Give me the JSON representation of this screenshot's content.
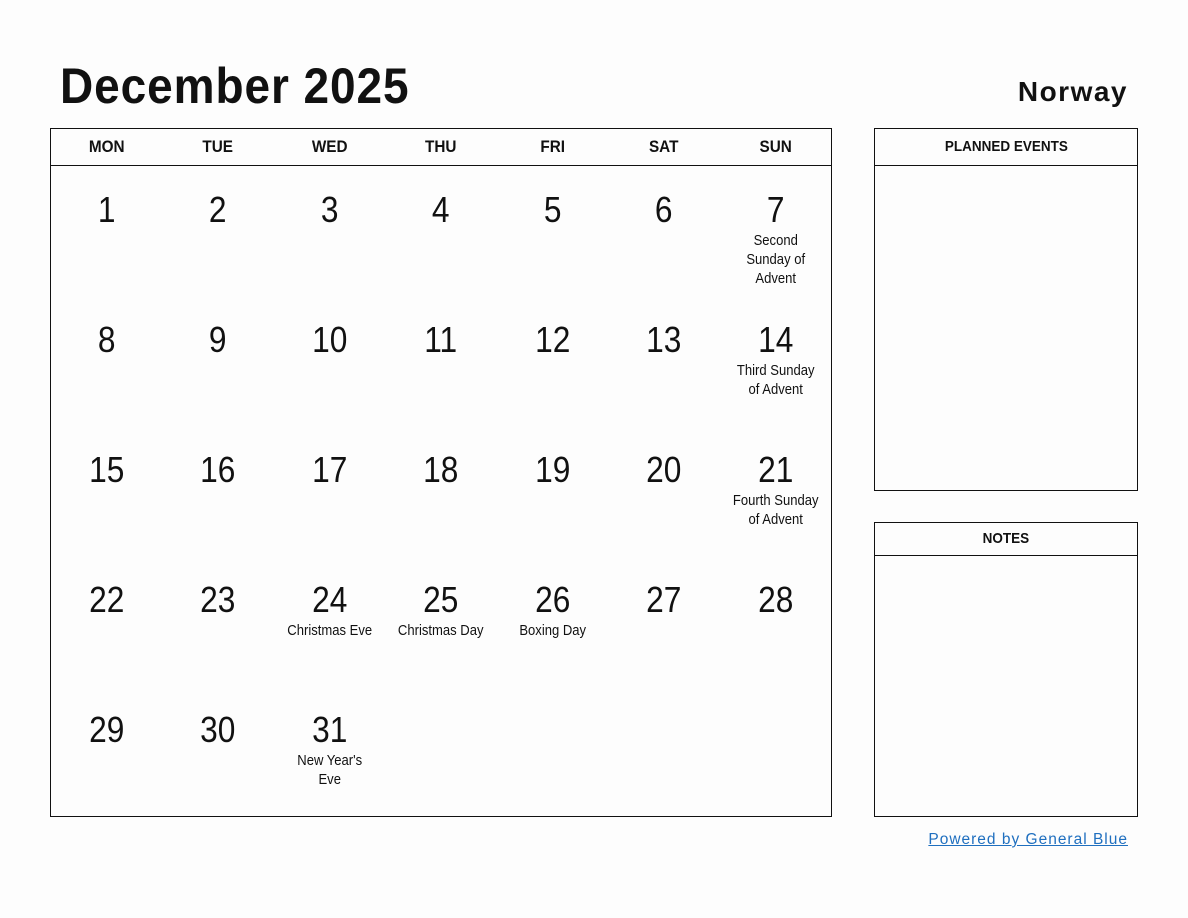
{
  "header": {
    "title": "December 2025",
    "country": "Norway"
  },
  "calendar": {
    "weekdays": [
      "MON",
      "TUE",
      "WED",
      "THU",
      "FRI",
      "SAT",
      "SUN"
    ],
    "weeks": [
      [
        {
          "day": "1",
          "holiday": ""
        },
        {
          "day": "2",
          "holiday": ""
        },
        {
          "day": "3",
          "holiday": ""
        },
        {
          "day": "4",
          "holiday": ""
        },
        {
          "day": "5",
          "holiday": ""
        },
        {
          "day": "6",
          "holiday": ""
        },
        {
          "day": "7",
          "holiday": "Second Sunday of Advent"
        }
      ],
      [
        {
          "day": "8",
          "holiday": ""
        },
        {
          "day": "9",
          "holiday": ""
        },
        {
          "day": "10",
          "holiday": ""
        },
        {
          "day": "11",
          "holiday": ""
        },
        {
          "day": "12",
          "holiday": ""
        },
        {
          "day": "13",
          "holiday": ""
        },
        {
          "day": "14",
          "holiday": "Third Sunday of Advent"
        }
      ],
      [
        {
          "day": "15",
          "holiday": ""
        },
        {
          "day": "16",
          "holiday": ""
        },
        {
          "day": "17",
          "holiday": ""
        },
        {
          "day": "18",
          "holiday": ""
        },
        {
          "day": "19",
          "holiday": ""
        },
        {
          "day": "20",
          "holiday": ""
        },
        {
          "day": "21",
          "holiday": "Fourth Sunday of Advent"
        }
      ],
      [
        {
          "day": "22",
          "holiday": ""
        },
        {
          "day": "23",
          "holiday": ""
        },
        {
          "day": "24",
          "holiday": "Christmas Eve"
        },
        {
          "day": "25",
          "holiday": "Christmas Day"
        },
        {
          "day": "26",
          "holiday": "Boxing Day"
        },
        {
          "day": "27",
          "holiday": ""
        },
        {
          "day": "28",
          "holiday": ""
        }
      ],
      [
        {
          "day": "29",
          "holiday": ""
        },
        {
          "day": "30",
          "holiday": ""
        },
        {
          "day": "31",
          "holiday": "New Year's Eve"
        },
        {
          "day": "",
          "holiday": ""
        },
        {
          "day": "",
          "holiday": ""
        },
        {
          "day": "",
          "holiday": ""
        },
        {
          "day": "",
          "holiday": ""
        }
      ]
    ]
  },
  "panels": {
    "planned_events": "PLANNED EVENTS",
    "notes": "NOTES"
  },
  "footer": {
    "powered_by": "Powered by General Blue",
    "link_color": "#1f6fbf"
  }
}
